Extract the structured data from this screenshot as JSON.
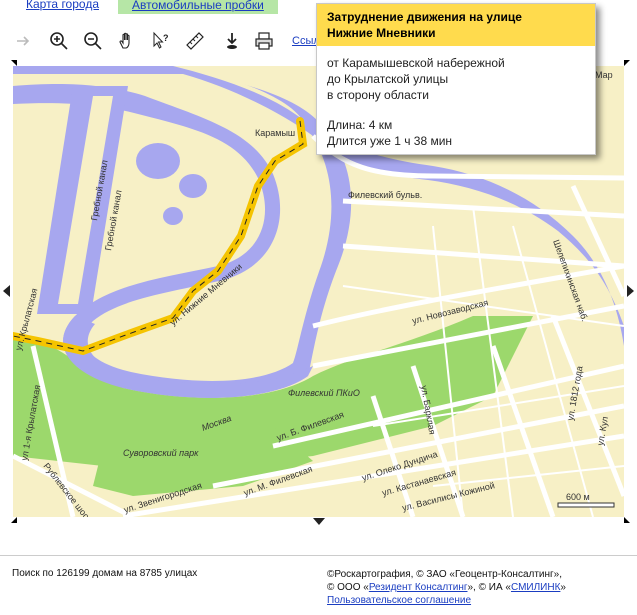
{
  "tabs": {
    "city_map": "Карта города",
    "traffic": "Автомобильные пробки"
  },
  "toolbar": {
    "tools": [
      "forward-icon",
      "zoom-in-icon",
      "zoom-out-icon",
      "hand-icon",
      "info-cursor-icon",
      "ruler-icon",
      "download-icon",
      "print-icon"
    ],
    "link_label": "Ссыл"
  },
  "popup": {
    "title_line1": "Затруднение движения на улице",
    "title_line2": "Нижние Мневники",
    "from": "от Карамышевской набережной",
    "to": "до Крылатской улицы",
    "direction": "в сторону области",
    "length": "Длина: 4 км",
    "duration": "Длится уже 1 ч 38 мин"
  },
  "map": {
    "labels": {
      "grebnoy1": "Гребной канал",
      "grebnoy2": "Гребной канал",
      "karam": "Карамыш",
      "mnevniki": "ул. Нижние Мневники",
      "filevsky_blvd": "Филевский бульв.",
      "novozavodskaya": "ул. Новозаводская",
      "krylatskaya": "ул. Крылатская",
      "krylatskaya1": "ул 1-я Крылатская",
      "filevsky_park": "Филевский ПКиО",
      "moskva": "Москва",
      "suvorovsky": "Суворовский парк",
      "rublevskoe": "Рублевское шоссе",
      "b_filevskaya": "ул. Б. Филевская",
      "m_filevskaya": "ул. М. Филевская",
      "zvenigorodskaya": "ул. Звенигородская",
      "barklaya": "ул. Барклая",
      "olek": "ул. Олеко Дундича",
      "kastanaevskaya": "ул. Кастанаевская",
      "v_kozhinoy": "ул. Василисы Кожиной",
      "shelepikhinskaya": "Шелепихинская наб.",
      "godovogo": "ул. 1812 года",
      "kul": "ул. Кул",
      "mar": "Мар",
      "scale": "600 м"
    },
    "colors": {
      "land": "#f7f0c6",
      "water": "#a7a7ef",
      "park": "#9cd86c",
      "road": "#ffffff",
      "jam": "#f5c400"
    }
  },
  "footer": {
    "search_text": "Поиск по 126199 домам на 8785 улицах",
    "copy1": "©Роскартография, © ЗАО «Геоцентр-Консалтинг»,",
    "copy2_pre": "© ООО «",
    "copy2_link1": "Резидент Консалтинг",
    "copy2_mid": "», © ИА «",
    "copy2_link2": "СМИЛИНК",
    "copy2_post": "»",
    "agreement": "Пользовательское соглашение"
  }
}
